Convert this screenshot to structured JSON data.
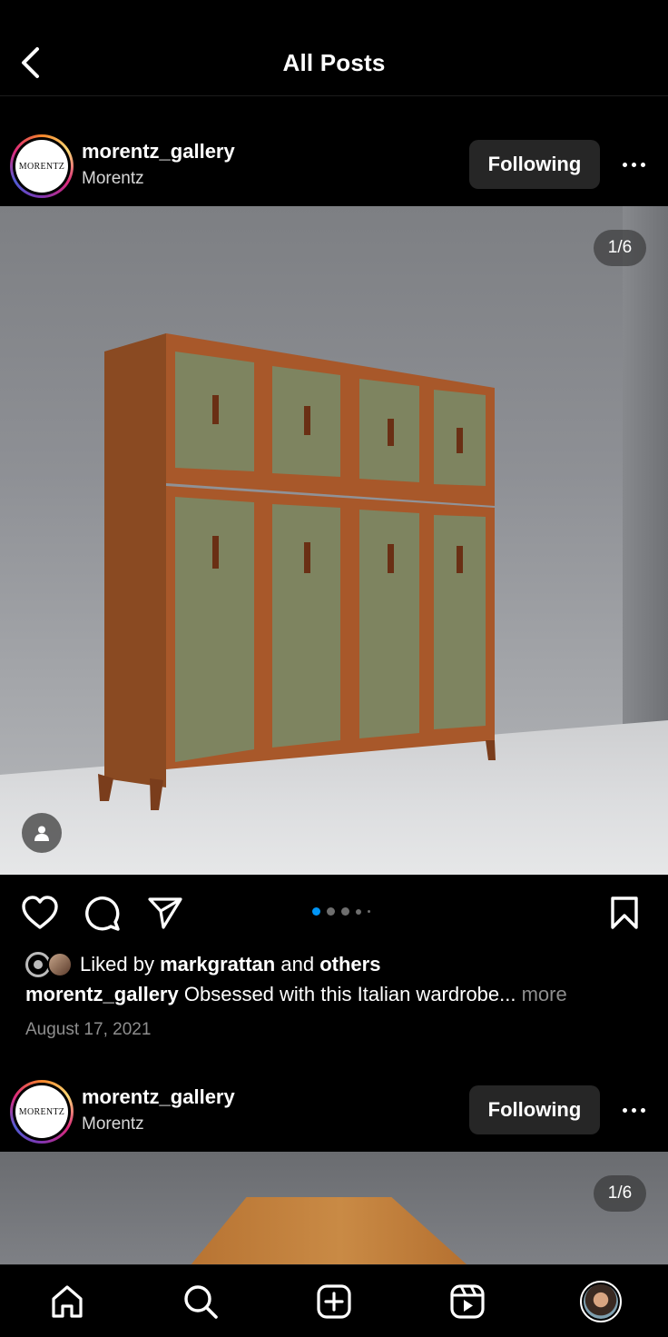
{
  "header": {
    "title": "All Posts"
  },
  "posts": [
    {
      "username": "morentz_gallery",
      "subname": "Morentz",
      "avatar_text": "MORENTZ",
      "follow_label": "Following",
      "image_counter": "1/6",
      "likes": {
        "prefix": "Liked by",
        "user": "markgrattan",
        "joiner": "and",
        "others": "others"
      },
      "caption": {
        "author": "morentz_gallery",
        "text": "Obsessed with this Italian wardrobe...",
        "more": "more"
      },
      "date": "August 17, 2021",
      "carousel": {
        "current": 1,
        "total": 6
      }
    },
    {
      "username": "morentz_gallery",
      "subname": "Morentz",
      "avatar_text": "MORENTZ",
      "follow_label": "Following",
      "image_counter": "1/6"
    }
  ],
  "icons": {
    "back": "chevron-left-icon",
    "more": "ellipsis-icon",
    "like": "heart-icon",
    "comment": "comment-icon",
    "share": "paper-plane-icon",
    "save": "bookmark-icon",
    "tag": "person-icon",
    "tabs": [
      "home-icon",
      "search-icon",
      "create-icon",
      "reels-icon",
      "profile-avatar"
    ]
  },
  "colors": {
    "background": "#000000",
    "button": "#262626",
    "muted": "#8e8e8e",
    "carousel_active": "#0095f6"
  }
}
